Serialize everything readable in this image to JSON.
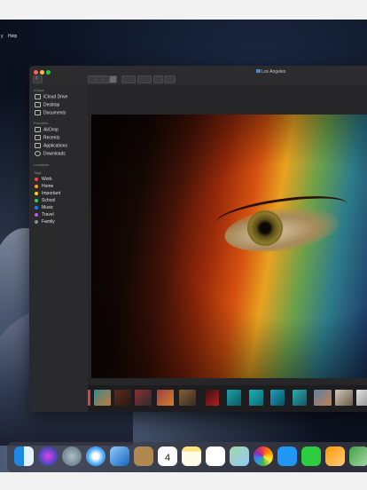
{
  "menubar": {
    "items": [
      "y",
      "Help"
    ]
  },
  "window": {
    "title": "Los Angeles",
    "toolbar": {
      "view_buttons": [
        "icon-view",
        "list-view",
        "column-view",
        "gallery-view"
      ],
      "group_button": "group-menu",
      "action_button": "gear-menu",
      "share_button": "share-icon",
      "tag_button": "tag-icon"
    }
  },
  "sidebar": {
    "icloud_heading": "iCloud",
    "icloud": [
      "iCloud Drive",
      "Desktop",
      "Documents"
    ],
    "favorites_heading": "Favorites",
    "favorites": [
      "AirDrop",
      "Recents",
      "Applications",
      "Downloads"
    ],
    "locations_heading": "Locations",
    "tags_heading": "Tags",
    "tags": [
      {
        "label": "Work",
        "color": "#ff453a"
      },
      {
        "label": "Home",
        "color": "#ff9f0a"
      },
      {
        "label": "Important",
        "color": "#ffd60a"
      },
      {
        "label": "School",
        "color": "#30d158"
      },
      {
        "label": "Music",
        "color": "#0a84ff"
      },
      {
        "label": "Travel",
        "color": "#bf5af2"
      },
      {
        "label": "Family",
        "color": "#8e8e93"
      }
    ]
  },
  "preview": {
    "subject": "close-up-eye-photo"
  },
  "dock": {
    "items": [
      "finder-icon",
      "siri-icon",
      "launchpad-icon",
      "safari-icon",
      "photo-browser-icon",
      "contacts-icon",
      "calendar-icon",
      "notes-icon",
      "reminders-icon",
      "maps-icon",
      "photos-icon",
      "messages-icon",
      "facetime-icon",
      "pages-icon",
      "numbers-icon"
    ],
    "calendar_date": "4"
  }
}
